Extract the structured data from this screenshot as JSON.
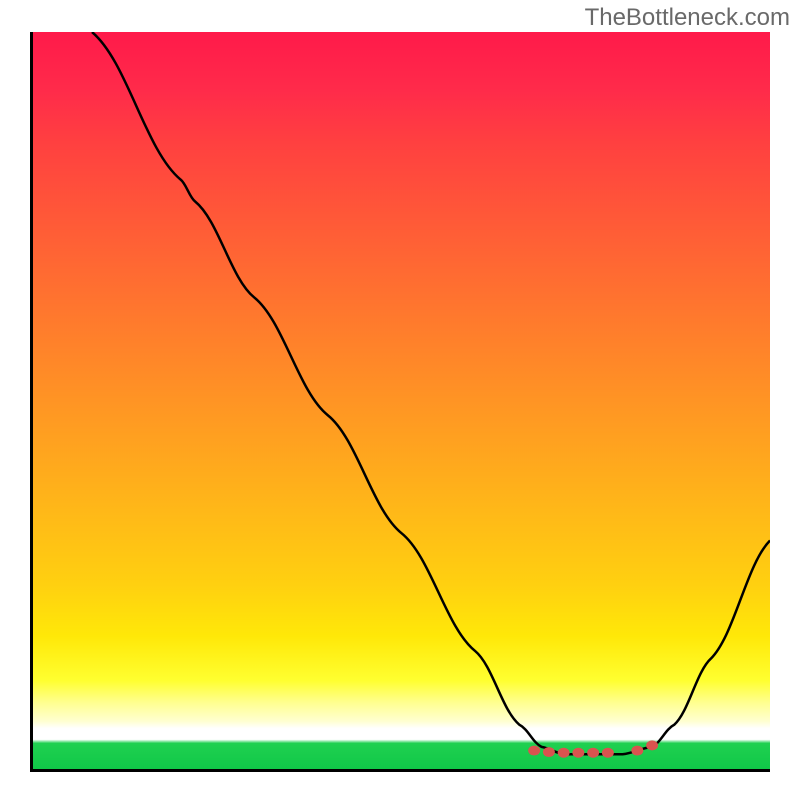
{
  "attribution": "TheBottleneck.com",
  "chart_data": {
    "type": "line",
    "title": "",
    "xlabel": "",
    "ylabel": "",
    "xlim": [
      0,
      100
    ],
    "ylim": [
      0,
      100
    ],
    "curve_points": [
      {
        "x": 8,
        "y": 100
      },
      {
        "x": 20,
        "y": 80
      },
      {
        "x": 22,
        "y": 77
      },
      {
        "x": 30,
        "y": 64
      },
      {
        "x": 40,
        "y": 48
      },
      {
        "x": 50,
        "y": 32
      },
      {
        "x": 60,
        "y": 16
      },
      {
        "x": 66,
        "y": 6
      },
      {
        "x": 69,
        "y": 3
      },
      {
        "x": 72,
        "y": 2
      },
      {
        "x": 76,
        "y": 2
      },
      {
        "x": 80,
        "y": 2
      },
      {
        "x": 84,
        "y": 3
      },
      {
        "x": 87,
        "y": 6
      },
      {
        "x": 92,
        "y": 15
      },
      {
        "x": 100,
        "y": 31
      }
    ],
    "marker_points": [
      {
        "x": 68,
        "y": 2.5
      },
      {
        "x": 70,
        "y": 2.3
      },
      {
        "x": 72,
        "y": 2.2
      },
      {
        "x": 74,
        "y": 2.2
      },
      {
        "x": 76,
        "y": 2.2
      },
      {
        "x": 78,
        "y": 2.2
      },
      {
        "x": 82,
        "y": 2.5
      },
      {
        "x": 84,
        "y": 3.2
      }
    ],
    "marker_color": "#d9534f",
    "curve_color": "#000000",
    "gradient_colors": {
      "top": "#ff1a4a",
      "mid_high": "#ff8828",
      "mid_low": "#ffe808",
      "pale": "#ffffd0",
      "bottom": "#10c848"
    }
  }
}
